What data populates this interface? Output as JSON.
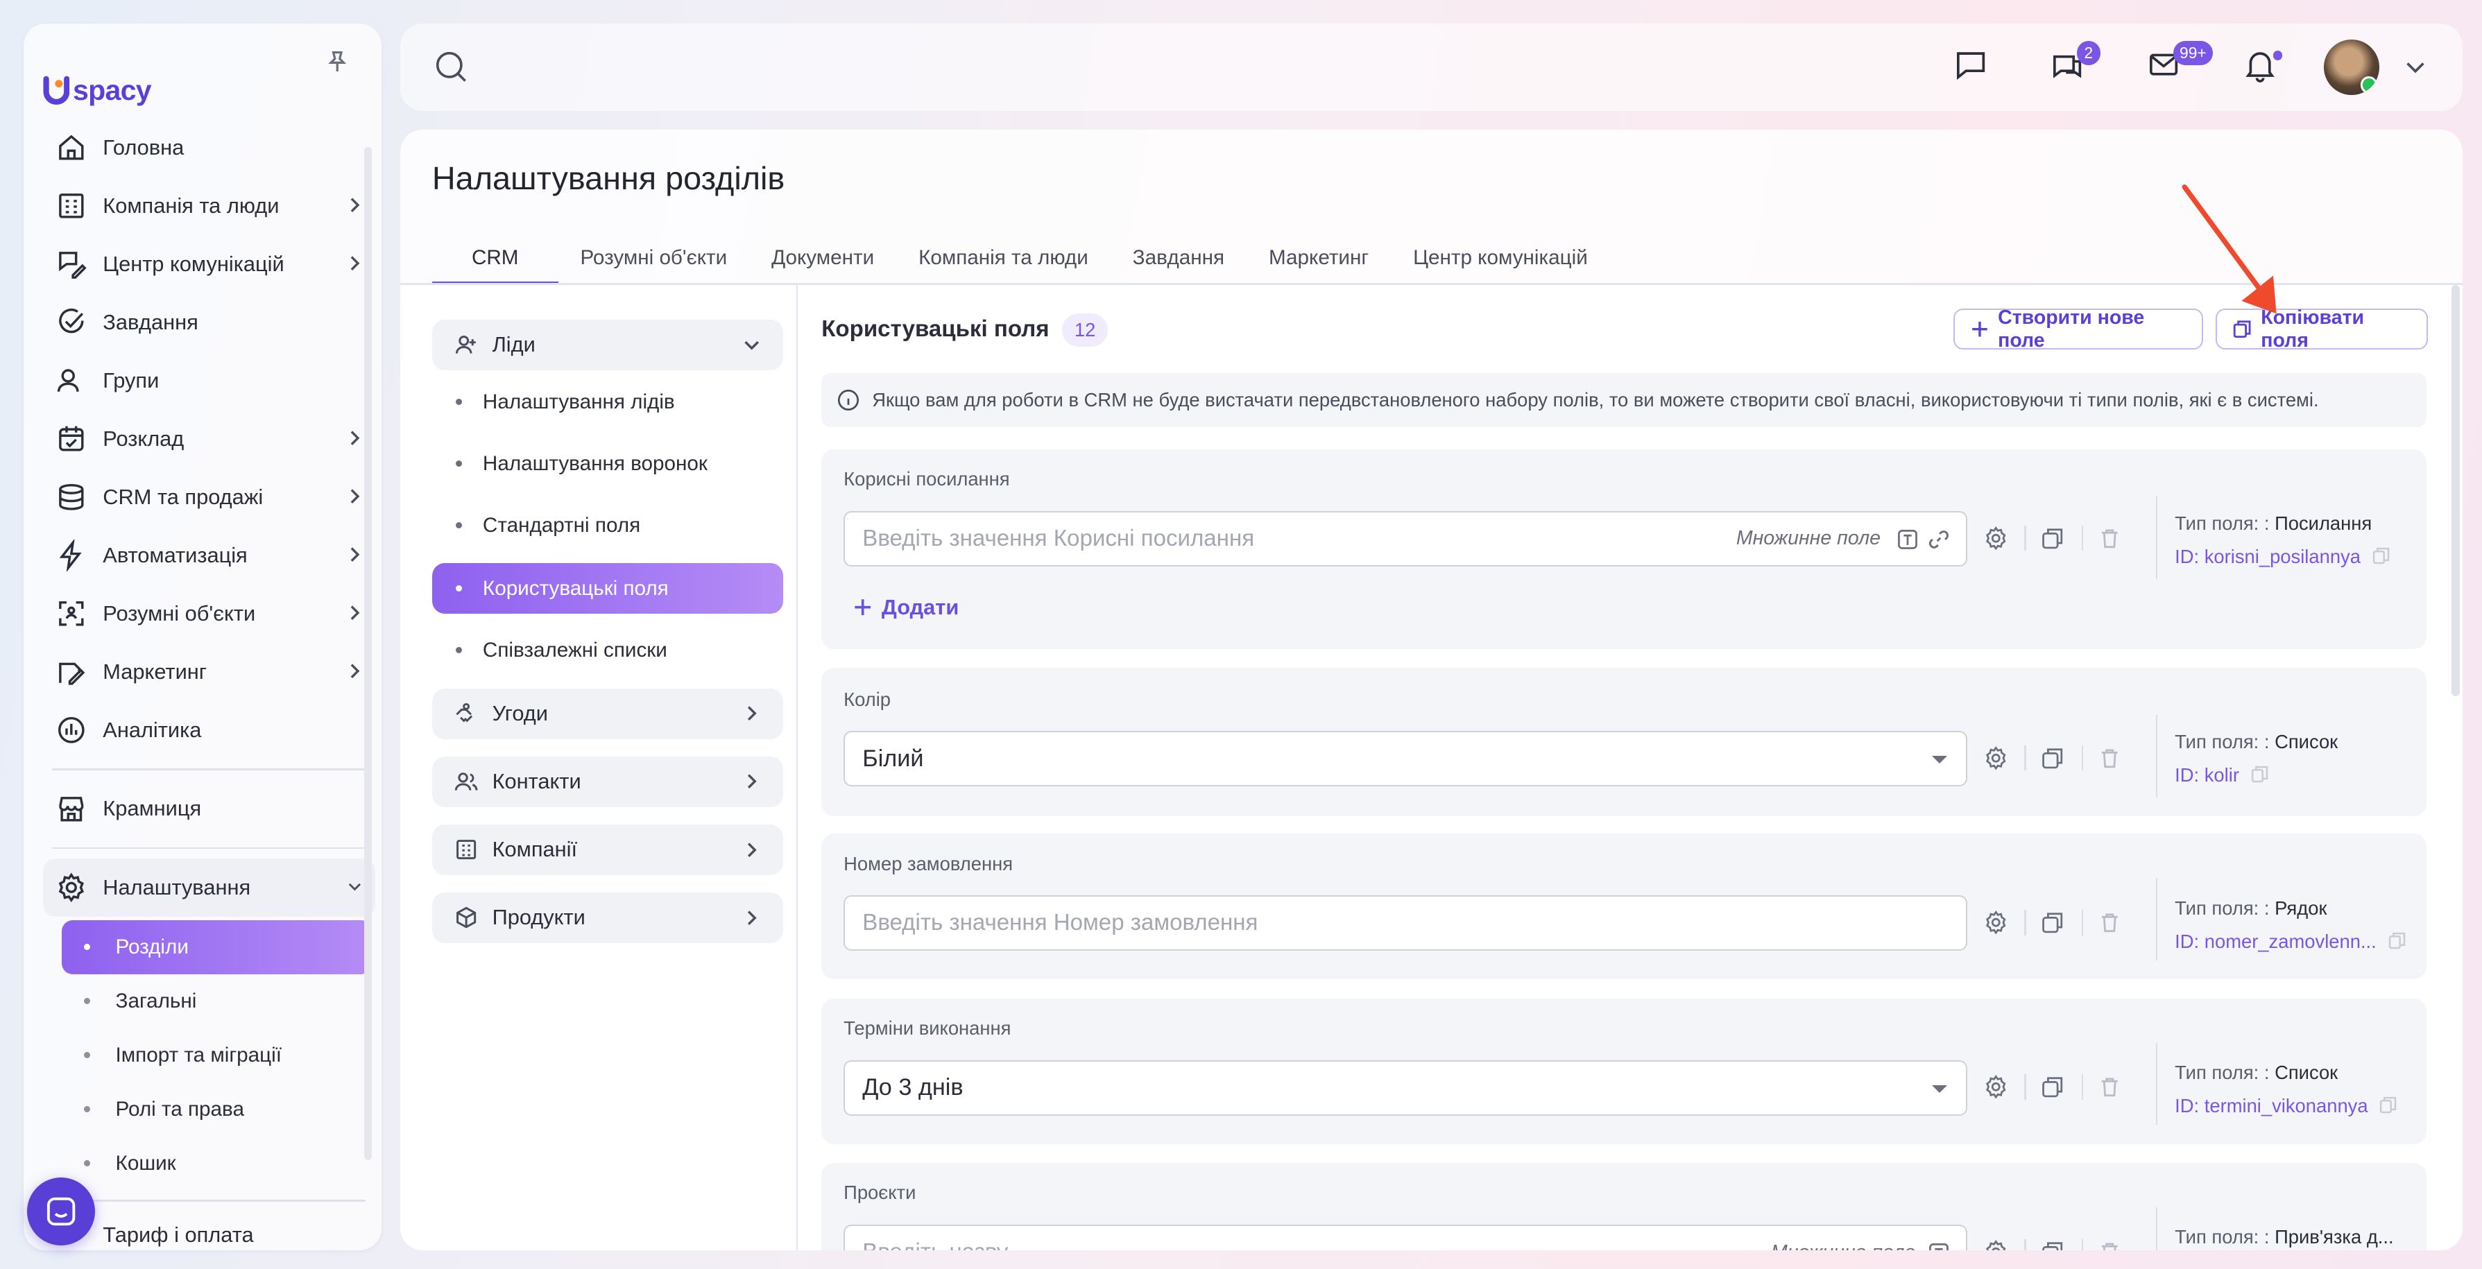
{
  "brand": {
    "name": "spacy",
    "logo_letter": "U",
    "color": "#5b3fd6"
  },
  "sidebar": {
    "items": [
      {
        "label": "Головна",
        "icon": "home-icon",
        "has_children": false
      },
      {
        "label": "Компанія та люди",
        "icon": "building-icon",
        "has_children": true
      },
      {
        "label": "Центр комунікацій",
        "icon": "chat-edit-icon",
        "has_children": true
      },
      {
        "label": "Завдання",
        "icon": "check-circle-icon",
        "has_children": false
      },
      {
        "label": "Групи",
        "icon": "users-icon",
        "has_children": false
      },
      {
        "label": "Розклад",
        "icon": "calendar-icon",
        "has_children": true
      },
      {
        "label": "CRM та продажі",
        "icon": "database-icon",
        "has_children": true
      },
      {
        "label": "Автоматизація",
        "icon": "bolt-icon",
        "has_children": true
      },
      {
        "label": "Розумні об'єкти",
        "icon": "scan-icon",
        "has_children": true
      },
      {
        "label": "Маркетинг",
        "icon": "megaphone-icon",
        "has_children": true
      },
      {
        "label": "Аналітика",
        "icon": "analytics-icon",
        "has_children": false
      }
    ],
    "store": {
      "label": "Крамниця",
      "icon": "store-icon"
    },
    "settings": {
      "label": "Налаштування",
      "icon": "gear-icon",
      "children": [
        "Розділи",
        "Загальні",
        "Імпорт та міграції",
        "Ролі та права",
        "Кошик"
      ],
      "active": "Розділи"
    },
    "billing": "Тариф і оплата"
  },
  "topbar": {
    "chat_badge": "2",
    "mail_badge": "99+"
  },
  "page": {
    "title": "Налаштування розділів",
    "tabs": [
      "CRM",
      "Розумні об'єкти",
      "Документи",
      "Компанія та люди",
      "Завдання",
      "Маркетинг",
      "Центр комунікацій"
    ],
    "active_tab": "CRM"
  },
  "subnav": {
    "leads": {
      "label": "Ліди",
      "items": [
        "Налаштування лідів",
        "Налаштування воронок",
        "Стандартні поля",
        "Користувацькі поля",
        "Співзалежні списки"
      ],
      "active": "Користувацькі поля"
    },
    "groups": [
      "Угоди",
      "Контакти",
      "Компанії",
      "Продукти"
    ]
  },
  "content": {
    "title": "Користувацькі поля",
    "count": "12",
    "create_button": "Створити нове поле",
    "copy_button": "Копіювати поля",
    "info": "Якщо вам для роботи в CRM не буде вистачати передвстановленого набору полів, то ви можете створити свої власні, використовуючи ті типи полів, які є в системі.",
    "type_prefix": "Тип поля: :",
    "fields": [
      {
        "label": "Корисні посилання",
        "placeholder": "Введіть значення Корисні посилання",
        "multi": "Множинне поле",
        "add": "Додати",
        "type": "Посилання",
        "id": "ID: korisni_posilannya"
      },
      {
        "label": "Колір",
        "value": "Білий",
        "type": "Список",
        "id": "ID: kolir"
      },
      {
        "label": "Номер замовлення",
        "placeholder": "Введіть значення Номер замовлення",
        "type": "Рядок",
        "id": "ID: nomer_zamovlenn..."
      },
      {
        "label": "Терміни виконання",
        "value": "До 3 днів",
        "type": "Список",
        "id": "ID: termini_vikonannya"
      },
      {
        "label": "Проєкти",
        "placeholder": "Введіть назву",
        "multi": "Множинне поле",
        "type": "Прив'язка д...",
        "id": ""
      }
    ]
  },
  "colors": {
    "accent": "#7a55e6",
    "accent_gradient_start": "#8e61ef",
    "accent_gradient_end": "#b58cf6",
    "arrow": "#f04a2c"
  }
}
